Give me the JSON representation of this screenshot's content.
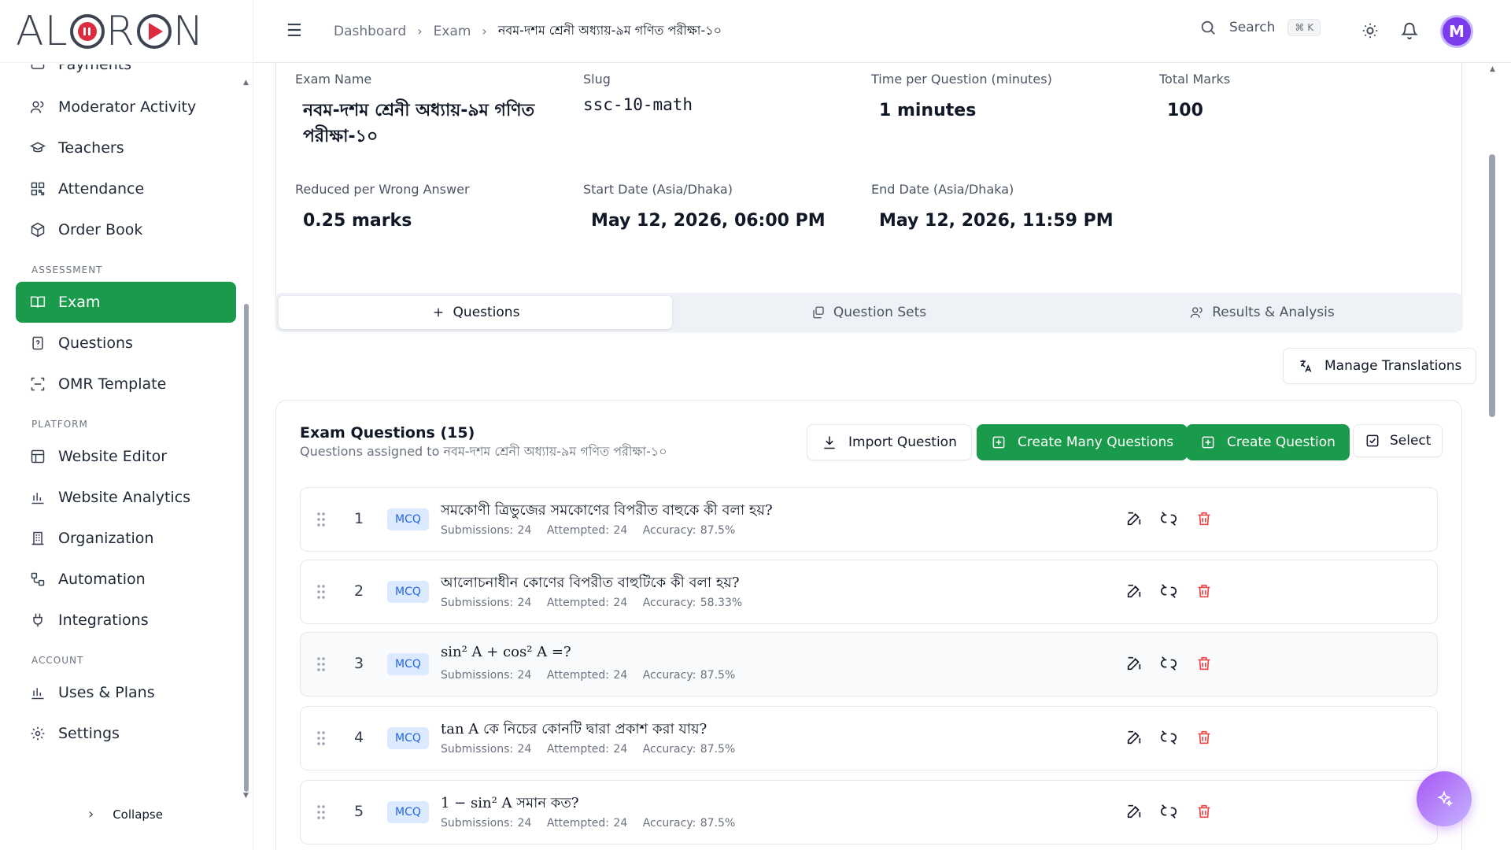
{
  "brand": {
    "logo_text": "ALORON"
  },
  "sidebar": {
    "partial_item": "Payments",
    "items_top": [
      {
        "label": "Moderator Activity",
        "icon": "users-icon"
      },
      {
        "label": "Teachers",
        "icon": "graduation-cap-icon"
      },
      {
        "label": "Attendance",
        "icon": "qr-code-icon"
      },
      {
        "label": "Order Book",
        "icon": "package-icon"
      }
    ],
    "section_assessment": "ASSESSMENT",
    "items_assessment": [
      {
        "label": "Exam",
        "icon": "book-open-icon",
        "active": true
      },
      {
        "label": "Questions",
        "icon": "file-question-icon"
      },
      {
        "label": "OMR Template",
        "icon": "scan-icon"
      }
    ],
    "section_platform": "PLATFORM",
    "items_platform": [
      {
        "label": "Website Editor",
        "icon": "layout-icon"
      },
      {
        "label": "Website Analytics",
        "icon": "bar-chart-icon"
      },
      {
        "label": "Organization",
        "icon": "building-icon"
      },
      {
        "label": "Automation",
        "icon": "workflow-icon"
      },
      {
        "label": "Integrations",
        "icon": "plug-icon"
      }
    ],
    "section_account": "ACCOUNT",
    "items_account": [
      {
        "label": "Uses & Plans",
        "icon": "bar-chart-icon"
      },
      {
        "label": "Settings",
        "icon": "gear-icon"
      }
    ],
    "collapse_label": "Collapse"
  },
  "header": {
    "breadcrumb": [
      "Dashboard",
      "Exam",
      "নবম-দশম শ্রেনী অধ্যায়-৯ম গণিত পরীক্ষা-১০"
    ],
    "search_label": "Search",
    "search_shortcut": "⌘ K",
    "avatar_letter": "M"
  },
  "exam": {
    "name_label": "Exam Name",
    "name_value": "নবম-দশম শ্রেনী অধ্যায়-৯ম গণিত পরীক্ষা-১০",
    "slug_label": "Slug",
    "slug_value": "ssc-10-math",
    "time_label": "Time per Question (minutes)",
    "time_value": "1 minutes",
    "marks_label": "Total Marks",
    "marks_value": "100",
    "reduced_label": "Reduced per Wrong Answer",
    "reduced_value": "0.25 marks",
    "start_label": "Start Date (Asia/Dhaka)",
    "start_value": "May 12, 2026, 06:00 PM",
    "end_label": "End Date (Asia/Dhaka)",
    "end_value": "May 12, 2026, 11:59 PM"
  },
  "tabs": {
    "questions": "Questions",
    "question_sets": "Question Sets",
    "results": "Results & Analysis"
  },
  "manage_translations": "Manage Translations",
  "questions_panel": {
    "title": "Exam Questions (15)",
    "subtitle": "Questions assigned to নবম-দশম শ্রেনী অধ্যায়-৯ম গণিত পরীক্ষা-১০",
    "import_label": "Import Question",
    "create_many_label": "Create Many Questions",
    "create_label": "Create Question",
    "select_label": "Select",
    "rows": [
      {
        "num": "1",
        "type": "MCQ",
        "text": "সমকোণী ত্রিভুজের সমকোণের বিপরীত বাহুকে কী বলা হয়?",
        "submissions": "Submissions: 24",
        "attempted": "Attempted: 24",
        "accuracy": "Accuracy: 87.5%"
      },
      {
        "num": "2",
        "type": "MCQ",
        "text": "আলোচনাধীন কোণের বিপরীত বাহুটিকে কী বলা হয়?",
        "submissions": "Submissions: 24",
        "attempted": "Attempted: 24",
        "accuracy": "Accuracy: 58.33%"
      },
      {
        "num": "3",
        "type": "MCQ",
        "text": "sin² A + cos² A =?",
        "submissions": "Submissions: 24",
        "attempted": "Attempted: 24",
        "accuracy": "Accuracy: 87.5%"
      },
      {
        "num": "4",
        "type": "MCQ",
        "text": "tan A কে নিচের কোনটি দ্বারা প্রকাশ করা যায়?",
        "submissions": "Submissions: 24",
        "attempted": "Attempted: 24",
        "accuracy": "Accuracy: 87.5%"
      },
      {
        "num": "5",
        "type": "MCQ",
        "text": "1 − sin² A সমান কত?",
        "submissions": "Submissions: 24",
        "attempted": "Attempted: 24",
        "accuracy": "Accuracy: 87.5%"
      }
    ]
  },
  "colors": {
    "accent": "#1a9a4b",
    "tag_bg": "#dbeafe",
    "tag_text": "#2563eb",
    "danger": "#ef4444",
    "avatar": "#7c3aed"
  }
}
